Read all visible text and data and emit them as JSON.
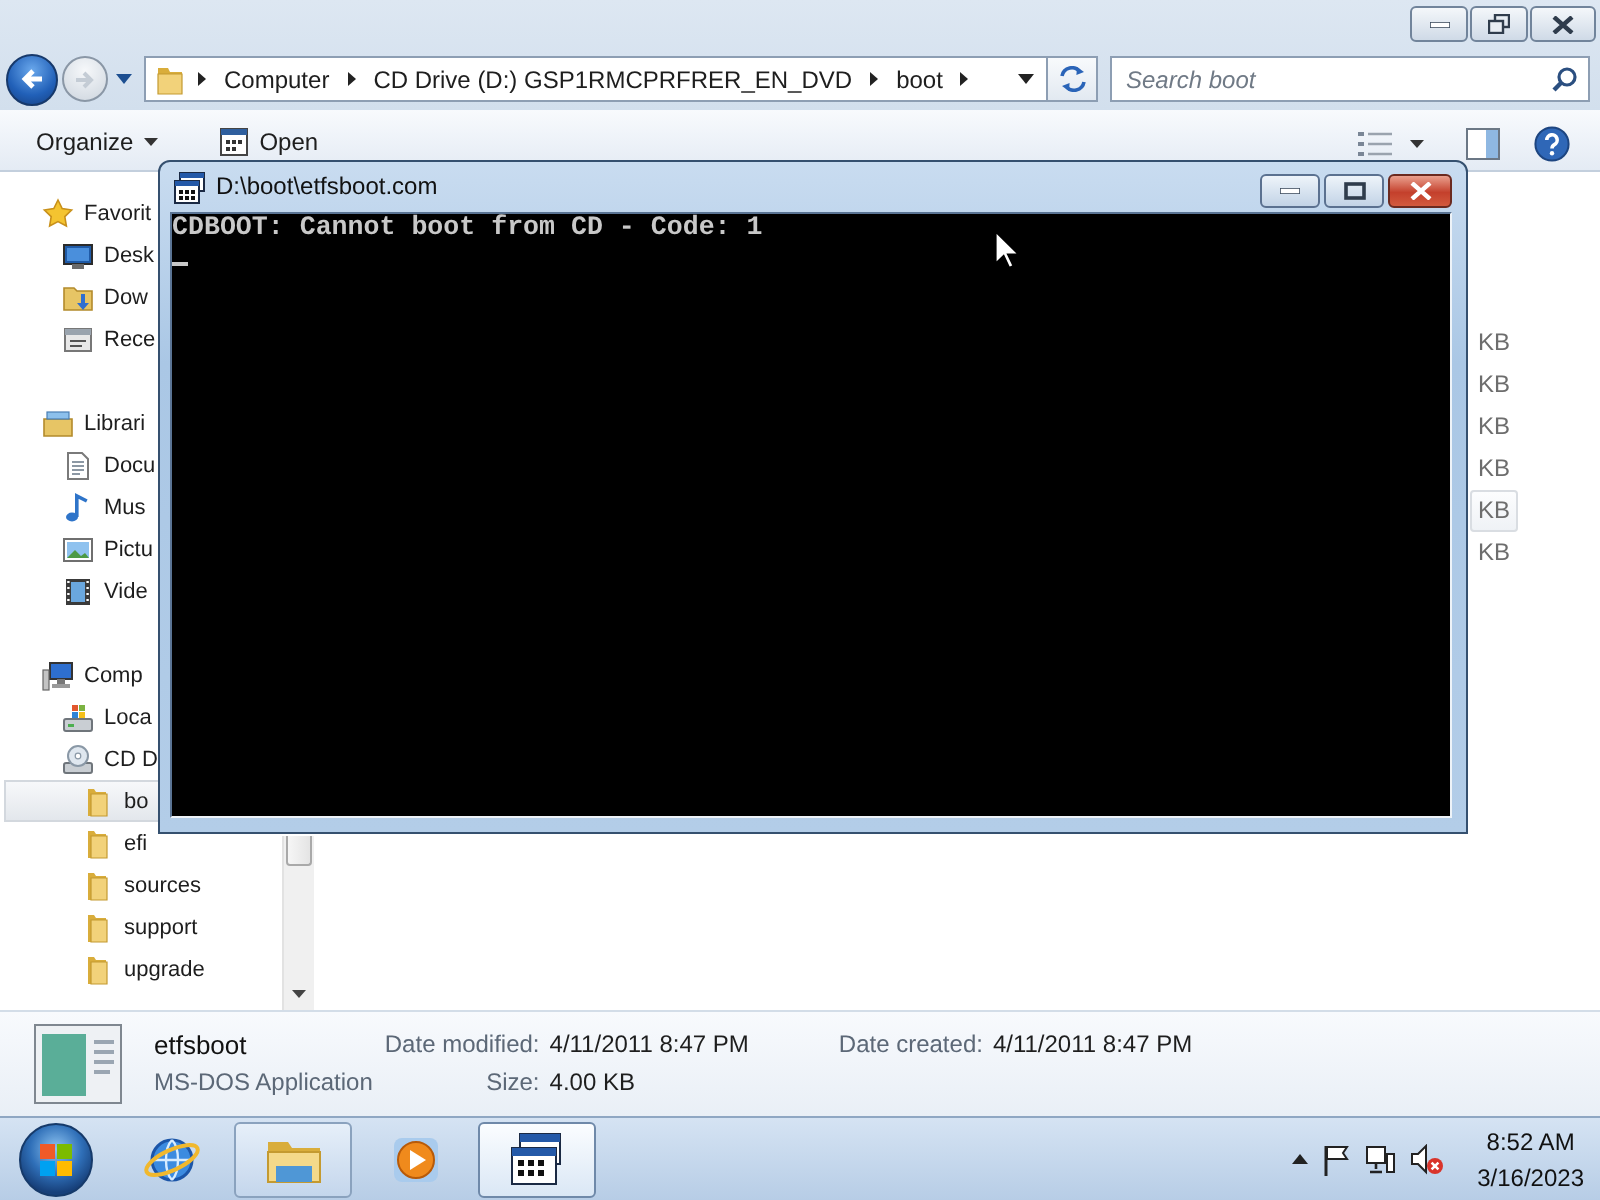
{
  "explorer": {
    "address_bar": {
      "back_disabled": false,
      "forward_disabled": true,
      "crumbs": [
        "Computer",
        "CD Drive (D:) GSP1RMCPRFRER_EN_DVD",
        "boot"
      ]
    },
    "search": {
      "placeholder": "Search boot"
    },
    "toolbar": [
      {
        "label": "Organize",
        "kind": "menu"
      },
      {
        "label": "Open",
        "kind": "command"
      }
    ],
    "nav_pane": [
      {
        "label": "Favorit",
        "kind": "star",
        "selected": false,
        "children": [
          {
            "label": "Desk",
            "kind": "desktop",
            "selected": false
          },
          {
            "label": "Dow",
            "kind": "download",
            "selected": false
          },
          {
            "label": "Rece",
            "kind": "recent",
            "selected": false
          }
        ]
      },
      {
        "label": "Librari",
        "kind": "library",
        "selected": false,
        "children": [
          {
            "label": "Docu",
            "kind": "document",
            "selected": false
          },
          {
            "label": "Mus",
            "kind": "music",
            "selected": false
          },
          {
            "label": "Pictu",
            "kind": "picture",
            "selected": false
          },
          {
            "label": "Vide",
            "kind": "video",
            "selected": false
          }
        ]
      },
      {
        "label": "Comp",
        "kind": "computer",
        "selected": false,
        "children": [
          {
            "label": "Loca",
            "kind": "disk",
            "selected": false
          },
          {
            "label": "CD D",
            "kind": "cd",
            "selected": false,
            "children": [
              {
                "label": "bo",
                "kind": "folder",
                "selected": true
              },
              {
                "label": "efi",
                "kind": "folder",
                "selected": false
              },
              {
                "label": "sources",
                "kind": "folder",
                "selected": false
              },
              {
                "label": "support",
                "kind": "folder",
                "selected": false
              },
              {
                "label": "upgrade",
                "kind": "folder",
                "selected": false
              }
            ]
          }
        ]
      }
    ],
    "file_list": [
      {
        "size": "KB",
        "highlighted": false
      },
      {
        "size": "KB",
        "highlighted": false
      },
      {
        "size": "KB",
        "highlighted": false
      },
      {
        "size": "KB",
        "highlighted": false
      },
      {
        "size": "KB",
        "highlighted": true
      },
      {
        "size": "KB",
        "highlighted": false
      }
    ],
    "details": {
      "name": "etfsboot",
      "type": "MS-DOS Application",
      "fields": [
        {
          "label": "Date modified:",
          "value": "4/11/2011 8:47 PM"
        },
        {
          "label": "Size:",
          "value": "4.00 KB"
        },
        {
          "label": "Date created:",
          "value": "4/11/2011 8:47 PM"
        }
      ]
    }
  },
  "console_window": {
    "title": "D:\\boot\\etfsboot.com",
    "lines": [
      "CDBOOT: Cannot boot from CD - Code: 1"
    ],
    "cursor": true
  },
  "taskbar": {
    "items": [
      {
        "kind": "browser",
        "running": false,
        "selected": false
      },
      {
        "kind": "explorer",
        "running": true,
        "selected": false
      },
      {
        "kind": "media",
        "running": false,
        "selected": false
      },
      {
        "kind": "console",
        "running": true,
        "selected": true
      }
    ],
    "clock": {
      "time": "8:52 AM",
      "date": "3/16/2023"
    }
  }
}
